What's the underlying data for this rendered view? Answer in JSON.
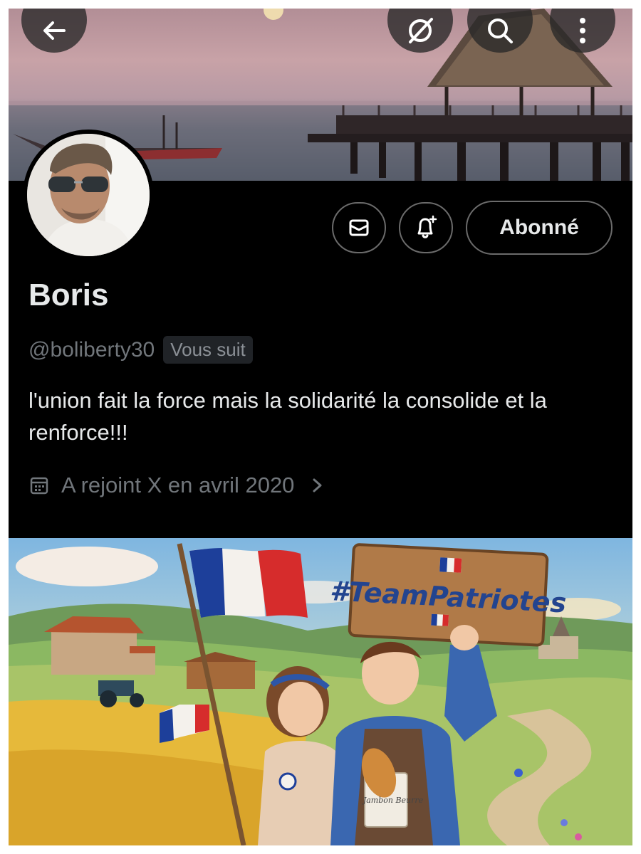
{
  "header": {
    "back_icon": "arrow-left-icon",
    "grok_icon": "grok-icon",
    "search_icon": "search-icon",
    "more_icon": "more-vertical-icon"
  },
  "profile": {
    "name": "Boris",
    "handle": "@boliberty30",
    "follows_you_badge": "Vous suit",
    "bio": "l'union fait la force mais la solidarité la consolide et la renforce!!!",
    "joined": "A rejoint X en avril 2020"
  },
  "actions": {
    "message_icon": "mail-icon",
    "notify_icon": "bell-plus-icon",
    "follow_label": "Abonné"
  },
  "post_image": {
    "sign_text": "#TeamPatriotes",
    "bag_text": "Jambon Beurre"
  },
  "colors": {
    "background": "#000000",
    "primary_text": "#e7e9ea",
    "secondary_text": "#71767b",
    "button_border": "#6b6b6b",
    "flag_blue": "#1d3f9a",
    "flag_red": "#d62c2c"
  }
}
